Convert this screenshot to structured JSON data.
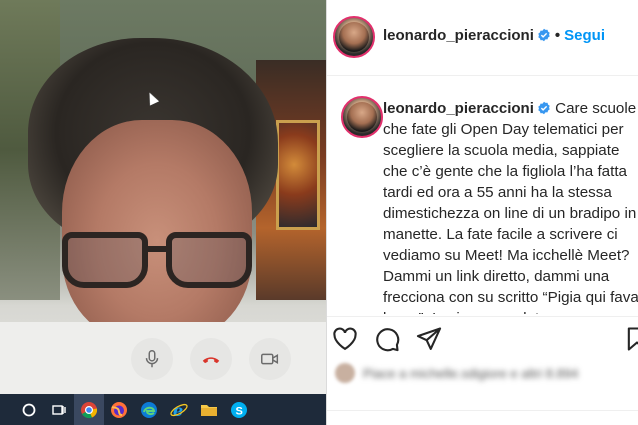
{
  "video_call": {
    "controls": [
      {
        "name": "mic-button",
        "icon": "microphone-icon"
      },
      {
        "name": "hangup-button",
        "icon": "phone-hangup-icon",
        "color": "#d9352b"
      },
      {
        "name": "camera-button",
        "icon": "video-camera-icon"
      }
    ]
  },
  "taskbar": {
    "items": [
      "start-search-icon",
      "task-view-icon",
      "chrome-icon",
      "firefox-icon",
      "edge-icon",
      "internet-explorer-icon",
      "file-explorer-icon",
      "skype-icon"
    ],
    "active": "chrome-icon"
  },
  "post": {
    "header": {
      "username": "leonardo_pieraccioni",
      "verified": true,
      "separator": "•",
      "follow_label": "Segui"
    },
    "caption": {
      "username": "leonardo_pieraccioni",
      "text": "Care scuole che fate gli Open Day telematici per scegliere la scuola media, sappiate che c’è gente che la figliola l’ha fatta tardi ed ora a 55 anni ha la stessa dimestichezza on line di un bradipo in manette. La fate facile a scrivere ci vediamo su Meet! Ma icchellè Meet? Dammi un link diretto, dammi una frecciona con su scritto “Pigia qui fava lessa”. Io ci sono andato su"
    },
    "actions": [
      "heart-icon",
      "comment-icon",
      "share-icon",
      "bookmark-icon"
    ],
    "likes_text": "Piace a michelle.sdigiore e altri 8.894"
  },
  "colors": {
    "accent": "#0095f6",
    "text": "#262626",
    "story_ring": "#e1306c"
  }
}
